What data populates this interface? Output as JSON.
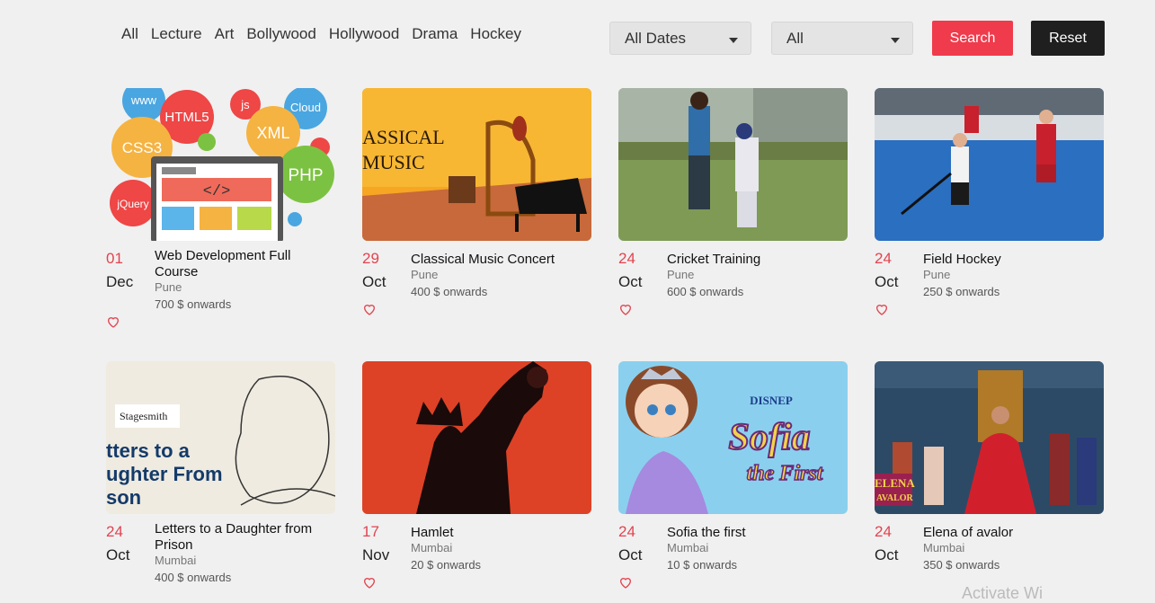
{
  "filters": {
    "categories": [
      "All",
      "Lecture",
      "Art",
      "Bollywood",
      "Hollywood",
      "Drama",
      "Hockey"
    ],
    "date_select": "All Dates",
    "type_select": "All",
    "search_label": "Search",
    "reset_label": "Reset"
  },
  "events": [
    {
      "day": "01",
      "month": "Dec",
      "title": "Web Development Full Course",
      "city": "Pune",
      "price": "700 $ onwards",
      "thumb_text": [
        "www",
        "HTML5",
        "js",
        "Cloud",
        "CSS3",
        "XML",
        "PHP",
        "jQuery",
        "</>"
      ]
    },
    {
      "day": "29",
      "month": "Oct",
      "title": "Classical Music Concert",
      "city": "Pune",
      "price": "400 $ onwards",
      "thumb_text": [
        "ASSICAL",
        "MUSIC"
      ]
    },
    {
      "day": "24",
      "month": "Oct",
      "title": "Cricket Training",
      "city": "Pune",
      "price": "600 $ onwards",
      "thumb_text": []
    },
    {
      "day": "24",
      "month": "Oct",
      "title": "Field Hockey",
      "city": "Pune",
      "price": "250 $ onwards",
      "thumb_text": []
    },
    {
      "day": "24",
      "month": "Oct",
      "title": "Letters to a Daughter from Prison",
      "city": "Mumbai",
      "price": "400 $ onwards",
      "thumb_text": [
        "Stagesmith",
        "tters to a",
        "ughter From",
        "son"
      ]
    },
    {
      "day": "17",
      "month": "Nov",
      "title": "Hamlet",
      "city": "Mumbai",
      "price": "20 $ onwards",
      "thumb_text": []
    },
    {
      "day": "24",
      "month": "Oct",
      "title": "Sofia the first",
      "city": "Mumbai",
      "price": "10 $ onwards",
      "thumb_text": [
        "DISNEP",
        "Sofia",
        "the First"
      ]
    },
    {
      "day": "24",
      "month": "Oct",
      "title": "Elena of avalor",
      "city": "Mumbai",
      "price": "350 $ onwards",
      "thumb_text": [
        "ELENA",
        "AVALOR"
      ]
    }
  ],
  "watermark": "Activate Wi"
}
